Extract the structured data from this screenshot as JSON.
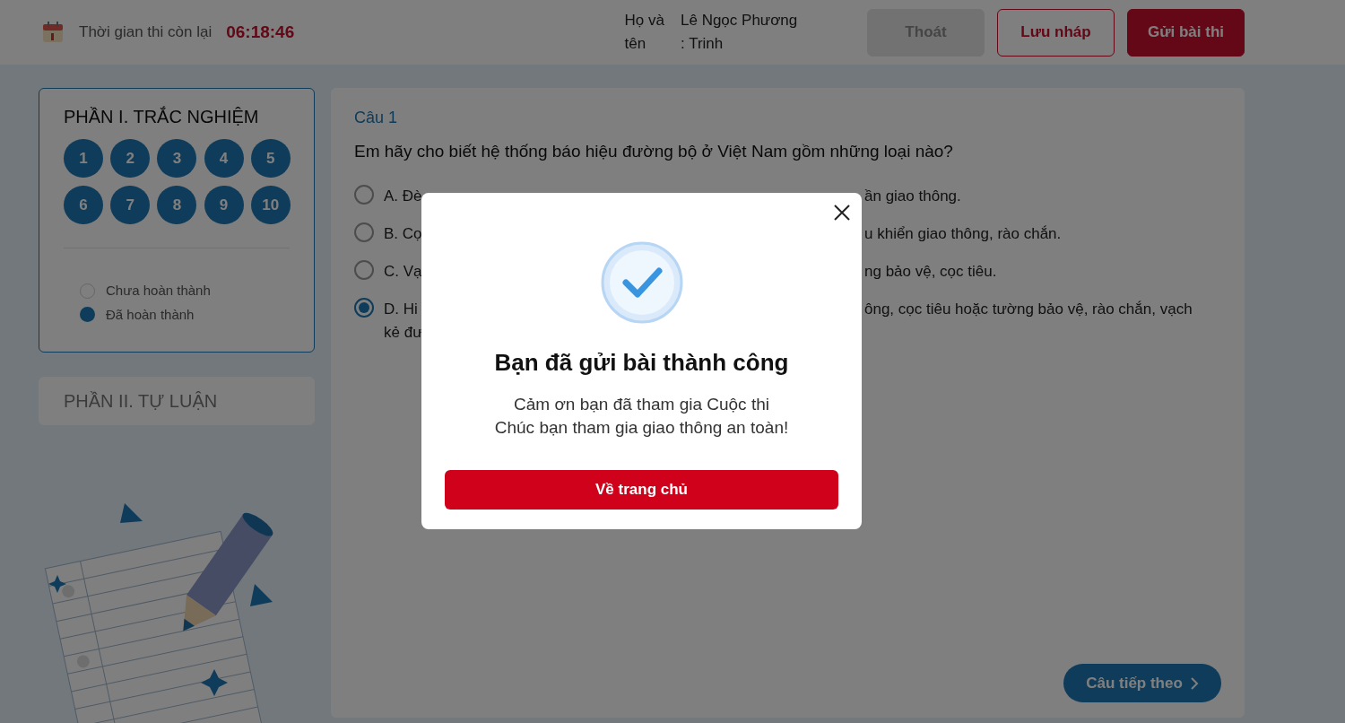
{
  "header": {
    "timer_label": "Thời gian thi còn lại",
    "timer_value": "06:18:46",
    "name_label_lines": [
      "Họ và",
      "tên"
    ],
    "name_value_lines": [
      "Lê Ngọc Phương",
      ": Trinh"
    ],
    "buttons": [
      {
        "kind": "muted",
        "label": "Thoát"
      },
      {
        "kind": "outline",
        "label": "Lưu nháp"
      },
      {
        "kind": "primary",
        "label": "Gửi bài thi"
      }
    ]
  },
  "sidebar": {
    "part1": {
      "title": "PHẦN I. TRẮC NGHIỆM",
      "selected": true,
      "questions": [
        {
          "label": "1",
          "done": true
        },
        {
          "label": "2",
          "done": true
        },
        {
          "label": "3",
          "done": true
        },
        {
          "label": "4",
          "done": true
        },
        {
          "label": "5",
          "done": true
        },
        {
          "label": "6",
          "done": true
        },
        {
          "label": "7",
          "done": true
        },
        {
          "label": "8",
          "done": true
        },
        {
          "label": "9",
          "done": true
        },
        {
          "label": "10",
          "done": true
        }
      ],
      "legend": [
        {
          "label": "Chưa hoàn thành",
          "done": false
        },
        {
          "label": "Đã hoàn thành",
          "done": true
        }
      ]
    },
    "part2": {
      "title": "PHẦN II. TỰ LUẬN",
      "selected": false
    }
  },
  "question": {
    "number": "Câu 1",
    "text": "Em hãy cho biết hệ thống báo hiệu đường bộ ở Việt Nam gồm những loại nào?",
    "options": [
      {
        "left_lines": [
          "A. Đè"
        ],
        "right": "ần giao thông.",
        "selected": false
      },
      {
        "left_lines": [
          "B. Cọ"
        ],
        "right": "u khiển giao thông, rào chắn.",
        "selected": false
      },
      {
        "left_lines": [
          "C. Vạ"
        ],
        "right": "ng bảo vệ, cọc tiêu.",
        "selected": false
      },
      {
        "left_lines": [
          "D. Hi",
          "kẻ đư"
        ],
        "right": "ông, cọc tiêu hoặc tường bảo vệ, rào chắn, vạch",
        "selected": true
      }
    ],
    "next_button": "Câu tiếp theo"
  },
  "modal": {
    "title": "Bạn đã gửi bài thành công",
    "message_lines": [
      "Cảm ơn bạn đã tham gia Cuộc thi",
      "Chúc bạn tham gia giao thông an toàn!"
    ],
    "button": "Về trang chủ"
  }
}
